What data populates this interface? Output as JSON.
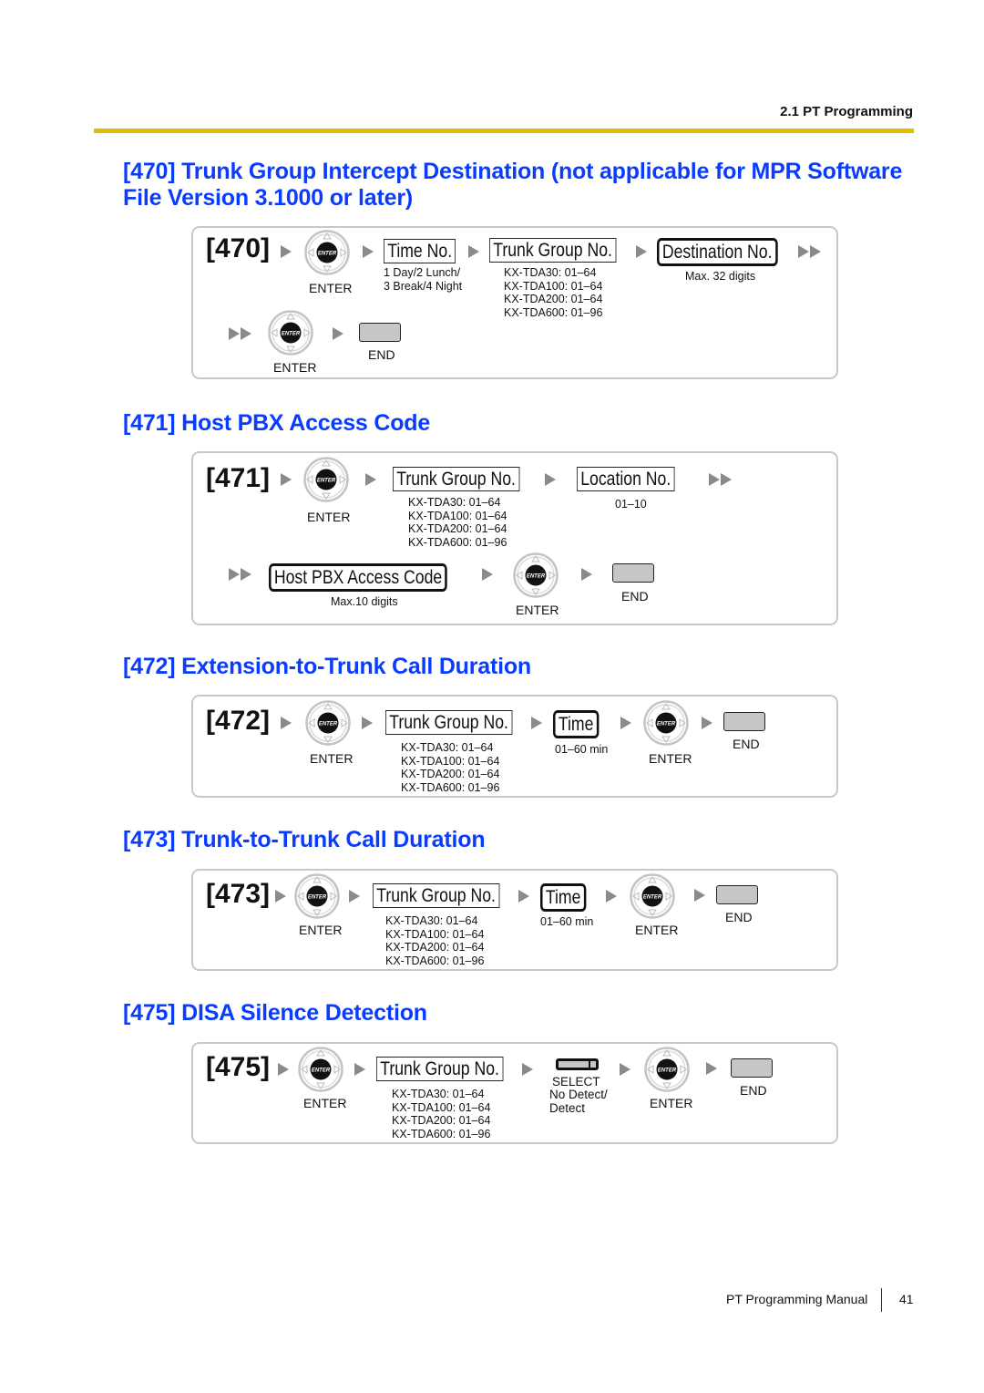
{
  "header": {
    "section": "2.1 PT Programming"
  },
  "sections": [
    {
      "title_line1": "[470] Trunk Group Intercept Destination (not applicable for MPR Software",
      "title_line2": "File Version 3.1000 or later)",
      "code": "[470]",
      "enter_label": "ENTER",
      "time_box": "Time No.",
      "time_note1": "1 Day/2 Lunch/",
      "time_note2": "3 Break/4 Night",
      "trunk_box": "Trunk Group No.",
      "dest_box": "Destination No.",
      "dest_note": "Max. 32 digits",
      "end_label": "END"
    },
    {
      "title": "[471] Host PBX Access Code",
      "code": "[471]",
      "enter_label": "ENTER",
      "trunk_box": "Trunk Group No.",
      "location_box": "Location No.",
      "location_note": "01–10",
      "host_box": "Host PBX Access Code",
      "host_note": "Max.10 digits",
      "end_label": "END"
    },
    {
      "title": "[472] Extension-to-Trunk Call Duration",
      "code": "[472]",
      "enter_label": "ENTER",
      "trunk_box": "Trunk Group No.",
      "time_box": "Time",
      "time_note": "01–60 min",
      "end_label": "END"
    },
    {
      "title": "[473] Trunk-to-Trunk Call Duration",
      "code": "[473]",
      "enter_label": "ENTER",
      "trunk_box": "Trunk Group No.",
      "time_box": "Time",
      "time_note": "01–60 min",
      "end_label": "END"
    },
    {
      "title": "[475] DISA Silence Detection",
      "code": "[475]",
      "enter_label": "ENTER",
      "trunk_box": "Trunk Group No.",
      "select_label": "SELECT",
      "select_note1": "No Detect/",
      "select_note2": "Detect",
      "end_label": "END"
    }
  ],
  "trunk_ranges": [
    "KX-TDA30: 01–64",
    "KX-TDA100: 01–64",
    "KX-TDA200: 01–64",
    "KX-TDA600: 01–96"
  ],
  "enter_key_text": "ENTER",
  "footer": {
    "manual": "PT Programming Manual",
    "page": "41"
  },
  "colors": {
    "title_blue": "#0a3cff",
    "header_bar": "#e2bd00",
    "panel_border": "#c8c8c8",
    "end_key": "#c6c6c6"
  }
}
